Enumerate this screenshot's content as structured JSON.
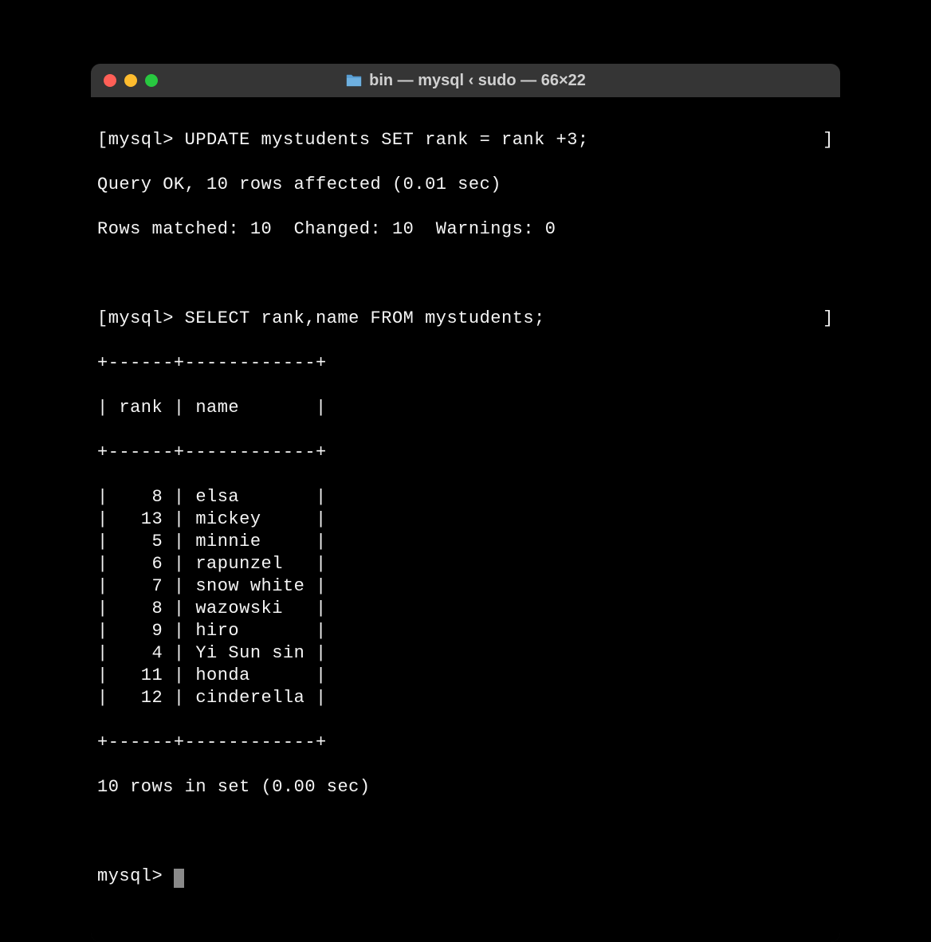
{
  "window": {
    "title": "bin — mysql ‹ sudo — 66×22"
  },
  "terminal": {
    "prompt": "mysql>",
    "lines": {
      "update_cmd": "UPDATE mystudents SET rank = rank +3;",
      "update_result1": "Query OK, 10 rows affected (0.01 sec)",
      "update_result2": "Rows matched: 10  Changed: 10  Warnings: 0",
      "select_cmd": "SELECT rank,name FROM mystudents;",
      "table_border": "+------+------------+",
      "table_header": "| rank | name       |",
      "footer": "10 rows in set (0.00 sec)"
    },
    "table_rows": [
      {
        "rank": 8,
        "name": "elsa"
      },
      {
        "rank": 13,
        "name": "mickey"
      },
      {
        "rank": 5,
        "name": "minnie"
      },
      {
        "rank": 6,
        "name": "rapunzel"
      },
      {
        "rank": 7,
        "name": "snow white"
      },
      {
        "rank": 8,
        "name": "wazowski"
      },
      {
        "rank": 9,
        "name": "hiro"
      },
      {
        "rank": 4,
        "name": "Yi Sun sin"
      },
      {
        "rank": 11,
        "name": "honda"
      },
      {
        "rank": 12,
        "name": "cinderella"
      }
    ]
  }
}
